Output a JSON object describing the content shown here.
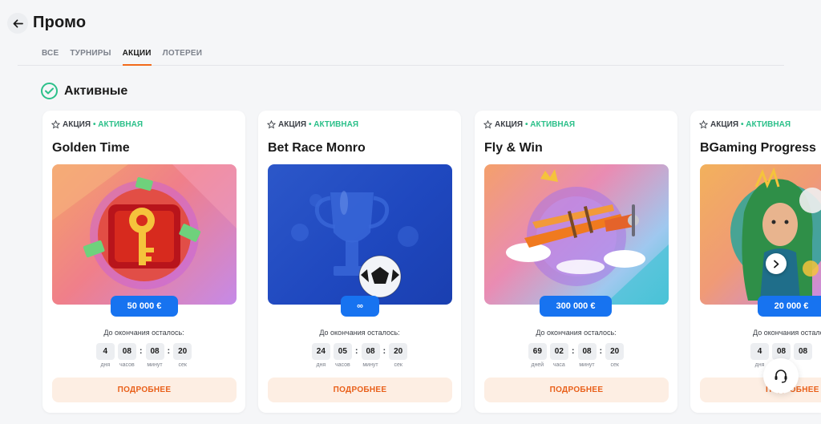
{
  "page": {
    "title": "Промо"
  },
  "tabs": [
    {
      "label": "ВСЕ"
    },
    {
      "label": "ТУРНИРЫ"
    },
    {
      "label": "АКЦИИ"
    },
    {
      "label": "ЛОТЕРЕИ"
    }
  ],
  "section": {
    "title": "Активные"
  },
  "cards": [
    {
      "type": "АКЦИЯ",
      "status": "• АКТИВНАЯ",
      "title": "Golden Time",
      "prize": "50 000 €",
      "remaining": "До окончания осталось:",
      "timer": [
        "4",
        "08",
        "08",
        "20"
      ],
      "units": [
        "дня",
        "часов",
        "минут",
        "сек"
      ],
      "button": "ПОДРОБНЕЕ"
    },
    {
      "type": "АКЦИЯ",
      "status": "• АКТИВНАЯ",
      "title": "Bet Race Monro",
      "prize": "∞",
      "remaining": "До окончания осталось:",
      "timer": [
        "24",
        "05",
        "08",
        "20"
      ],
      "units": [
        "дня",
        "часов",
        "минут",
        "сек"
      ],
      "button": "ПОДРОБНЕЕ"
    },
    {
      "type": "АКЦИЯ",
      "status": "• АКТИВНАЯ",
      "title": "Fly & Win",
      "prize": "300 000 €",
      "remaining": "До окончания осталось:",
      "timer": [
        "69",
        "02",
        "08",
        "20"
      ],
      "units": [
        "дней",
        "часа",
        "минут",
        "сек"
      ],
      "button": "ПОДРОБНЕЕ"
    },
    {
      "type": "АКЦИЯ",
      "status": "• АКТИВНАЯ",
      "title": "BGaming Progress",
      "prize": "20 000 €",
      "remaining": "До окончания осталось:",
      "timer": [
        "4",
        "08",
        "08"
      ],
      "units": [
        "дня"
      ],
      "button": "ПОДРОБНЕЕ"
    }
  ],
  "colors": {
    "accent": "#f26a1b",
    "active": "#2cc08a",
    "prize": "#1773f0"
  },
  "icons": {
    "back": "arrow-left-icon",
    "check": "check-circle-icon",
    "star": "star-outline-icon",
    "next": "chevron-right-icon",
    "support": "headset-icon"
  }
}
